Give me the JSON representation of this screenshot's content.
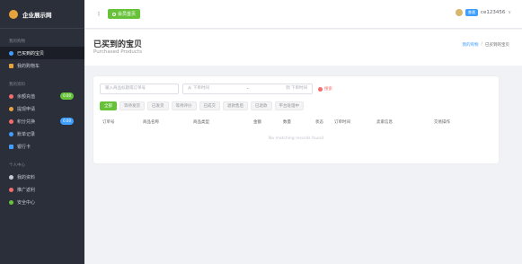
{
  "app": {
    "name": "企业展示网"
  },
  "sidebar": {
    "groups": [
      {
        "title": "我的购物",
        "items": [
          {
            "label": "已买到的宝贝",
            "active": true,
            "color": "#409eff"
          },
          {
            "label": "我的购物车",
            "active": false,
            "color": "#e6a23c"
          }
        ]
      },
      {
        "title": "我的资料",
        "items": [
          {
            "label": "余额充值",
            "badge": "0.00",
            "badge_color": "#67c23a",
            "color": "#f56c6c"
          },
          {
            "label": "提现申请",
            "color": "#e6a23c"
          },
          {
            "label": "积分兑换",
            "badge": "0.00",
            "badge_color": "#409eff",
            "color": "#f56c6c"
          },
          {
            "label": "账单记录",
            "color": "#409eff"
          },
          {
            "label": "银行卡",
            "color": "#409eff"
          }
        ]
      },
      {
        "title": "个人中心",
        "items": [
          {
            "label": "我的资料",
            "color": "#c7cbd3"
          },
          {
            "label": "推广返利",
            "color": "#f56c6c"
          },
          {
            "label": "安全中心",
            "color": "#67c23a"
          }
        ]
      }
    ]
  },
  "topbar": {
    "menu_icon": "⁝",
    "home_label": "会员首页",
    "user_tag": "普通",
    "username": "ce123456",
    "caret": "∨"
  },
  "page": {
    "title": "已买到的宝贝",
    "subtitle": "Purchased Products",
    "breadcrumb": [
      "我的购物",
      "已买到的宝贝"
    ],
    "breadcrumb_sep": "/"
  },
  "filters": {
    "search_placeholder": "输入商品标题或订单号",
    "date_from": "从 下单时间",
    "date_sep": "-",
    "date_to": "到 下单时间",
    "search_label": "搜索"
  },
  "tabs": [
    "全部",
    "等待发货",
    "已发货",
    "等待评价",
    "已成交",
    "退款售后",
    "已退款",
    "平台处理中"
  ],
  "table": {
    "columns": [
      "订单号",
      "商品名称",
      "商品类型",
      "金额",
      "数量",
      "状态",
      "订单时间",
      "卖家信息",
      "交易操作"
    ],
    "empty_text": "No matching records found"
  }
}
